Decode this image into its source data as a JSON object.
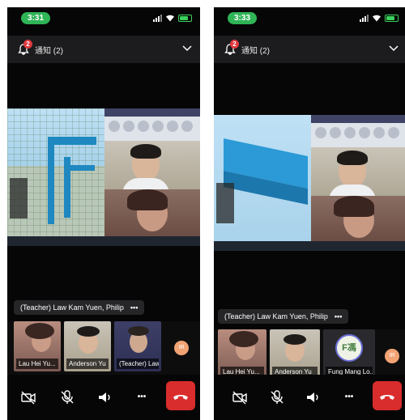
{
  "phones": [
    {
      "status_time": "3:31",
      "notification": {
        "badge": "2",
        "text": "通知 (2)"
      },
      "speaker_pill": "(Teacher) Law Kam Yuen, Philip",
      "more_glyph": "•••",
      "thumbnails": [
        {
          "label": "Lau Hei Yu..."
        },
        {
          "label": "Anderson Yu"
        },
        {
          "label": "(Teacher) Law..."
        }
      ],
      "avatar_initials": "IR"
    },
    {
      "status_time": "3:33",
      "notification": {
        "badge": "2",
        "text": "通知 (2)"
      },
      "speaker_pill": "(Teacher) Law Kam Yuen, Philip",
      "more_glyph": "•••",
      "thumbnails": [
        {
          "label": "Lau Hei Yu..."
        },
        {
          "label": "Anderson Yu"
        },
        {
          "label": "Fung Mang Lo..."
        }
      ],
      "fung_avatar_text": "F馮",
      "avatar_initials": "IR"
    }
  ],
  "controls": {
    "icons": [
      "camera-off-icon",
      "mic-off-icon",
      "speaker-icon",
      "more-icon",
      "hang-up-icon"
    ],
    "more_glyph": "•••"
  },
  "colors": {
    "time_pill": "#2fb456",
    "hangup": "#d92d2d",
    "badge": "#e0383e",
    "avatar_ir": "#f2a374",
    "minecraft_wall": "#1f88c0"
  }
}
